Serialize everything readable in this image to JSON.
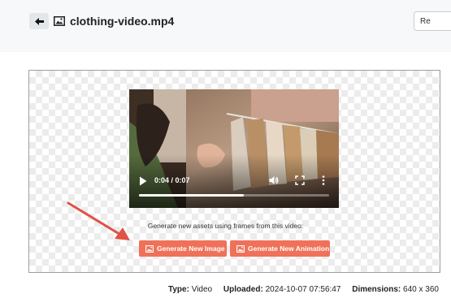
{
  "header": {
    "file_name": "clothing-video.mp4",
    "right_button_label": "Re",
    "back_icon": "arrow-left-icon",
    "file_icon": "image-icon"
  },
  "video": {
    "time_display": "0:04 / 0:07",
    "progress_fraction": 0.55,
    "controls": [
      "play-icon",
      "volume-icon",
      "fullscreen-icon",
      "more-icon"
    ]
  },
  "generate": {
    "hint": "Generate new assets using frames from this video:",
    "image_button": "Generate New Image",
    "animation_button": "Generate New Animation",
    "button_color": "#f07159"
  },
  "annotation": {
    "arrow_color": "#e05247"
  },
  "meta": {
    "type_label": "Type:",
    "type_value": "Video",
    "uploaded_label": "Uploaded:",
    "uploaded_value": "2024-10-07 07:56:47",
    "dimensions_label": "Dimensions:",
    "dimensions_value": "640 x 360"
  }
}
